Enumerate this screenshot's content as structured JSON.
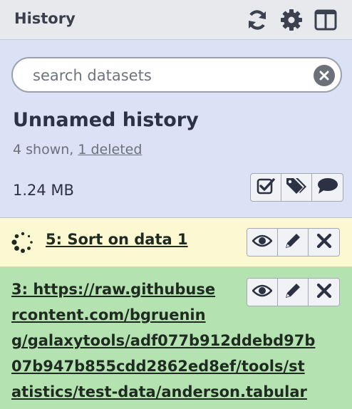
{
  "header": {
    "title": "History",
    "icons": [
      "refresh-icon",
      "gear-icon",
      "columns-icon"
    ]
  },
  "search": {
    "placeholder": "search datasets",
    "value": ""
  },
  "history": {
    "name": "Unnamed history",
    "shown_text": "4 shown, ",
    "deleted_text": "1 deleted",
    "size": "1.24 MB",
    "actions": [
      "select-items-icon",
      "tags-icon",
      "annotation-icon"
    ]
  },
  "datasets": [
    {
      "hid_title": "5: Sort on data 1",
      "state": "running",
      "state_color": "#fcf8d2"
    },
    {
      "hid_title": "3: https://raw.githubusercontent.com/bgruening/galaxytools/adf077b912ddebd97b07b947b855cdd2862ed8ef/tools/statistics/test-data/anderson.tabular",
      "title_lines": [
        "3: https://raw.githubuse",
        "rcontent.com/bgruenin",
        "g/galaxytools/adf077b912ddebd97b",
        "07b947b855cdd2862ed8ef/tools/st",
        "atistics/test-data/anderson.tabular"
      ],
      "state": "ok",
      "state_color": "#b4e2b1"
    }
  ],
  "dataset_actions": [
    "eye-icon",
    "pencil-icon",
    "delete-icon"
  ],
  "colors": {
    "header_bg": "#e8e9ed",
    "panel_bg": "#dbe2f5",
    "running_bg": "#fcf8d2",
    "ok_bg": "#b4e2b1"
  }
}
